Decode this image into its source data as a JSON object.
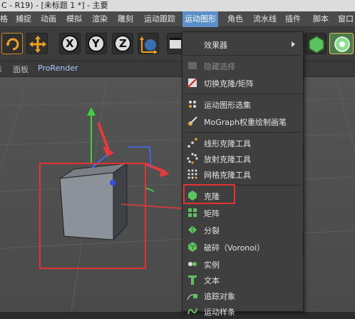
{
  "window": {
    "title": "C - R19) - [未标题 1 *] - 主要"
  },
  "menubar": {
    "items": [
      "格",
      "捕捉",
      "动画",
      "模拟",
      "渲染",
      "雕刻",
      "运动跟踪",
      "运动图形",
      "角色",
      "流水线",
      "插件",
      "脚本",
      "窗口"
    ],
    "active": "运动图形"
  },
  "toolbar": {
    "x_label": "X",
    "y_label": "Y",
    "z_label": "Z"
  },
  "subbar": {
    "panel": "面板",
    "prorender": "ProRender"
  },
  "menu": {
    "effectors": "效果器",
    "hide_selection": "隐藏选择",
    "toggle_clone_matrix": "切换克隆/矩阵",
    "mograph_selection": "运动图形选集",
    "mograph_weight_paint": "MoGraph权重绘制画笔",
    "linear_clone_tool": "线形克隆工具",
    "radial_clone_tool": "放射克隆工具",
    "grid_clone_tool": "网格克隆工具",
    "cloner": "克隆",
    "matrix": "矩阵",
    "fracture": "分裂",
    "voronoi_fracture": "破碎（Voronoi）",
    "instance": "实例",
    "text": "文本",
    "tracer": "追踪对象",
    "motion_spline": "运动样条"
  },
  "colors": {
    "accent": "#5b8fc9",
    "highlight_box": "#e23232",
    "cube": "#8c9299"
  }
}
